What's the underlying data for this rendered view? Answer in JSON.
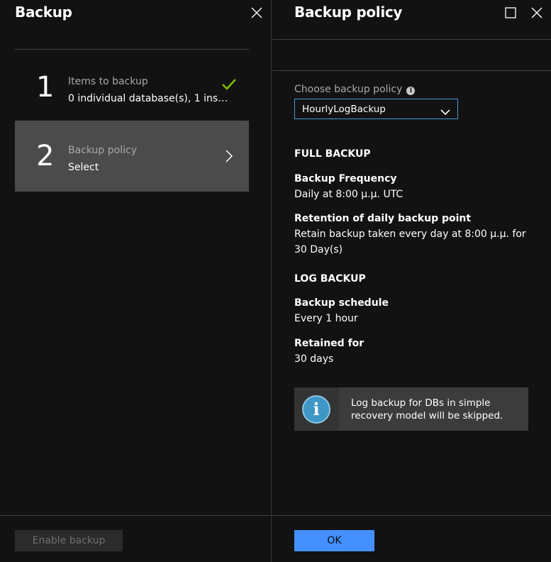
{
  "left_blade": {
    "title": "Backup",
    "steps": [
      {
        "number": "1",
        "title": "Items to backup",
        "value": "0 individual database(s), 1 insta...",
        "status": "complete"
      },
      {
        "number": "2",
        "title": "Backup policy",
        "value": "Select",
        "status": "active"
      }
    ],
    "enable_button": "Enable backup"
  },
  "right_blade": {
    "title": "Backup policy",
    "choose_label": "Choose backup policy",
    "selected_policy": "HourlyLogBackup",
    "full_backup": {
      "heading": "FULL BACKUP",
      "frequency_label": "Backup Frequency",
      "frequency_value": "Daily at 8:00 μ.μ. UTC",
      "retention_label": "Retention of daily backup point",
      "retention_value": "Retain backup taken every day at 8:00 μ.μ. for 30 Day(s)"
    },
    "log_backup": {
      "heading": "LOG BACKUP",
      "schedule_label": "Backup schedule",
      "schedule_value": "Every 1 hour",
      "retained_label": "Retained for",
      "retained_value": "30 days"
    },
    "info_message": "Log backup for DBs in simple recovery model will be skipped.",
    "ok_button": "OK"
  },
  "colors": {
    "accent": "#4590ff",
    "check": "#7fba00",
    "select_border": "#3e9bd8",
    "info_icon": "#3e97c7"
  },
  "icons": {
    "close": "close-icon",
    "maximize": "maximize-icon",
    "check": "checkmark-icon",
    "chevron_right": "chevron-right-icon",
    "chevron_down": "chevron-down-icon",
    "info": "info-icon"
  }
}
